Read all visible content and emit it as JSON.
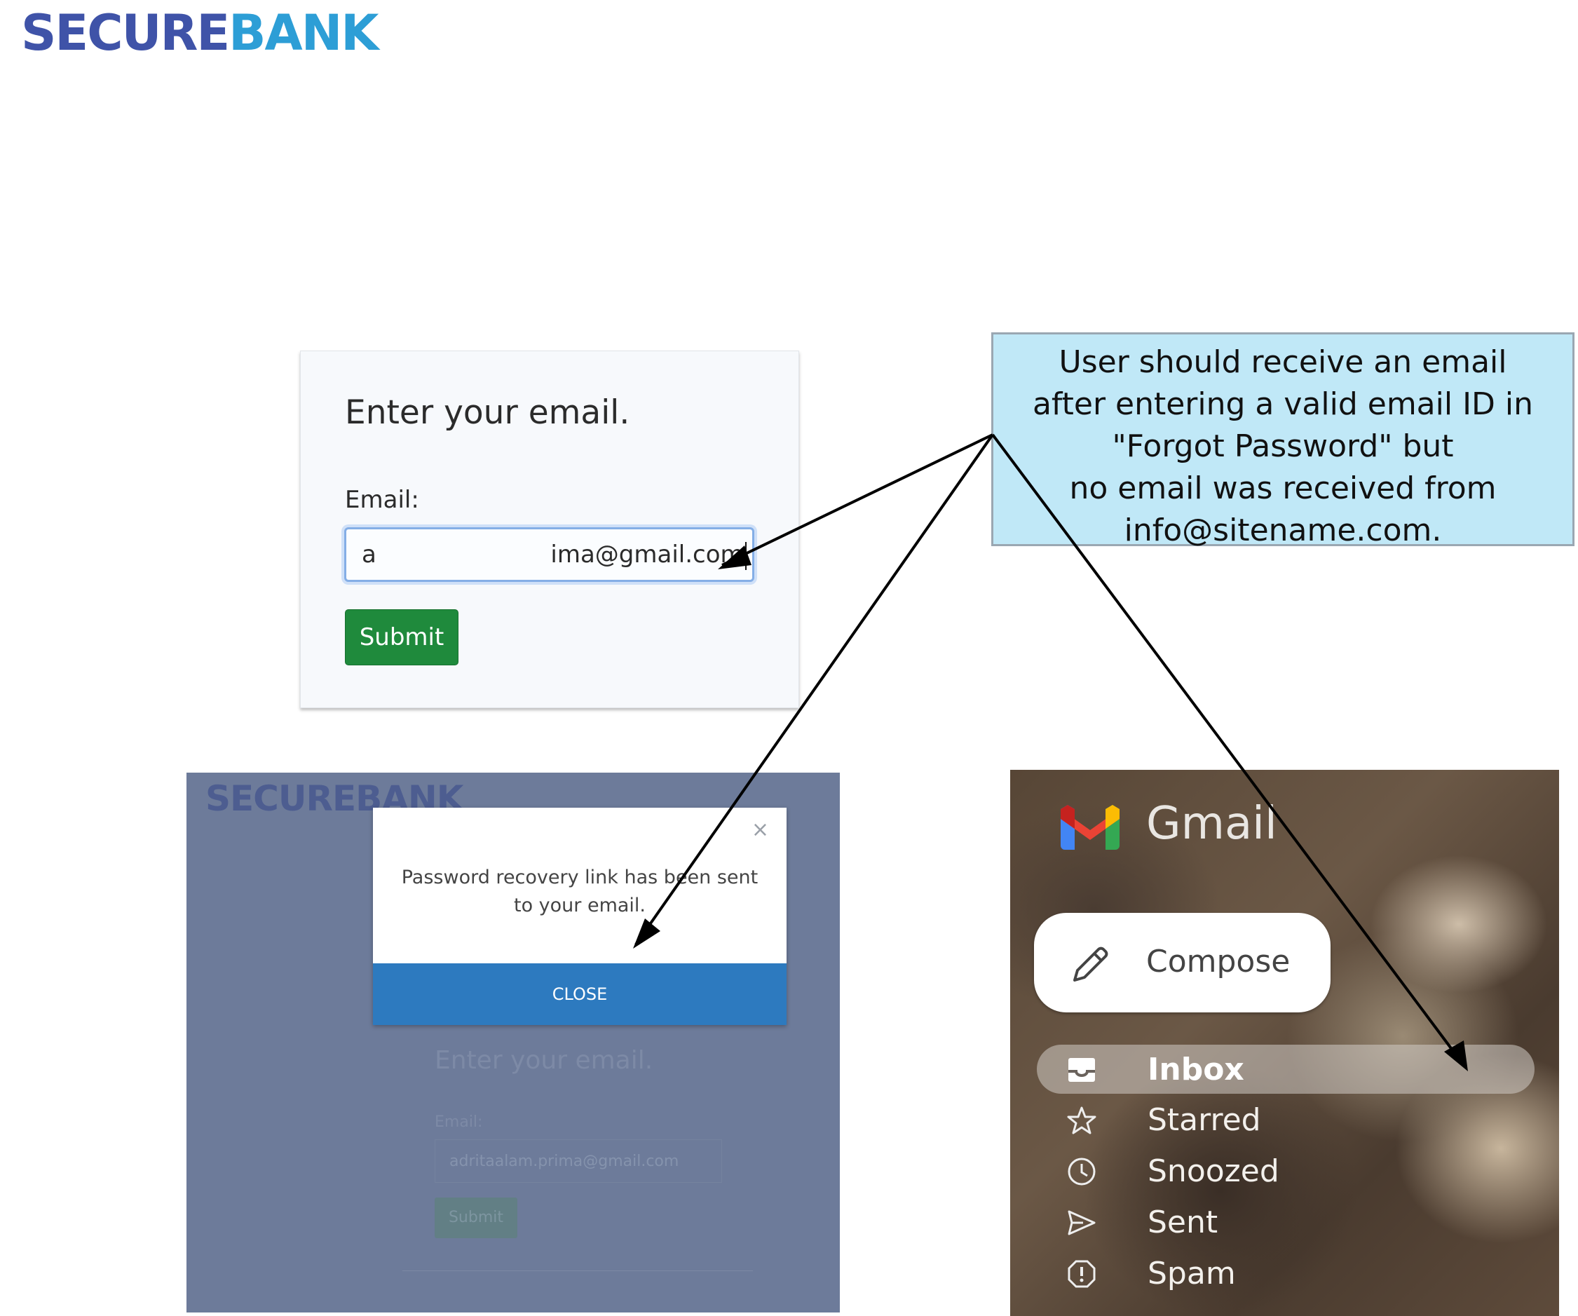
{
  "logo": {
    "part1": "SECURE",
    "part2": "BANK"
  },
  "forgot_card": {
    "title": "Enter your email.",
    "email_label": "Email:",
    "email_value": "a                       ima@gmail.com",
    "submit_label": "Submit"
  },
  "callout": {
    "lines": [
      "User should receive an email",
      "after entering a valid email ID in",
      "\"Forgot Password\" but",
      "no email was received from",
      "info@sitename.com."
    ]
  },
  "modal_screenshot": {
    "bg_logo": "SECUREBANK",
    "dialog_close_icon": "×",
    "dialog_message": "Password recovery link has been sent to your email.",
    "dialog_button": "CLOSE",
    "card_title": "Enter your email.",
    "card_label": "Email:",
    "card_email_value": "adritaalam.prima@gmail.com",
    "card_submit": "Submit"
  },
  "gmail": {
    "brand": "Gmail",
    "compose_label": "Compose",
    "nav": [
      {
        "label": "Inbox",
        "icon": "inbox-icon",
        "active": true
      },
      {
        "label": "Starred",
        "icon": "star-icon"
      },
      {
        "label": "Snoozed",
        "icon": "clock-icon"
      },
      {
        "label": "Sent",
        "icon": "send-icon"
      },
      {
        "label": "Spam",
        "icon": "spam-icon"
      }
    ]
  },
  "colors": {
    "logo_dark": "#3f53a8",
    "logo_light": "#2d9ed6",
    "submit_green": "#1f8a3c",
    "callout_bg": "#c0e8f7",
    "modal_overlay": "#6d7b9a",
    "dialog_button": "#2d7abf"
  }
}
